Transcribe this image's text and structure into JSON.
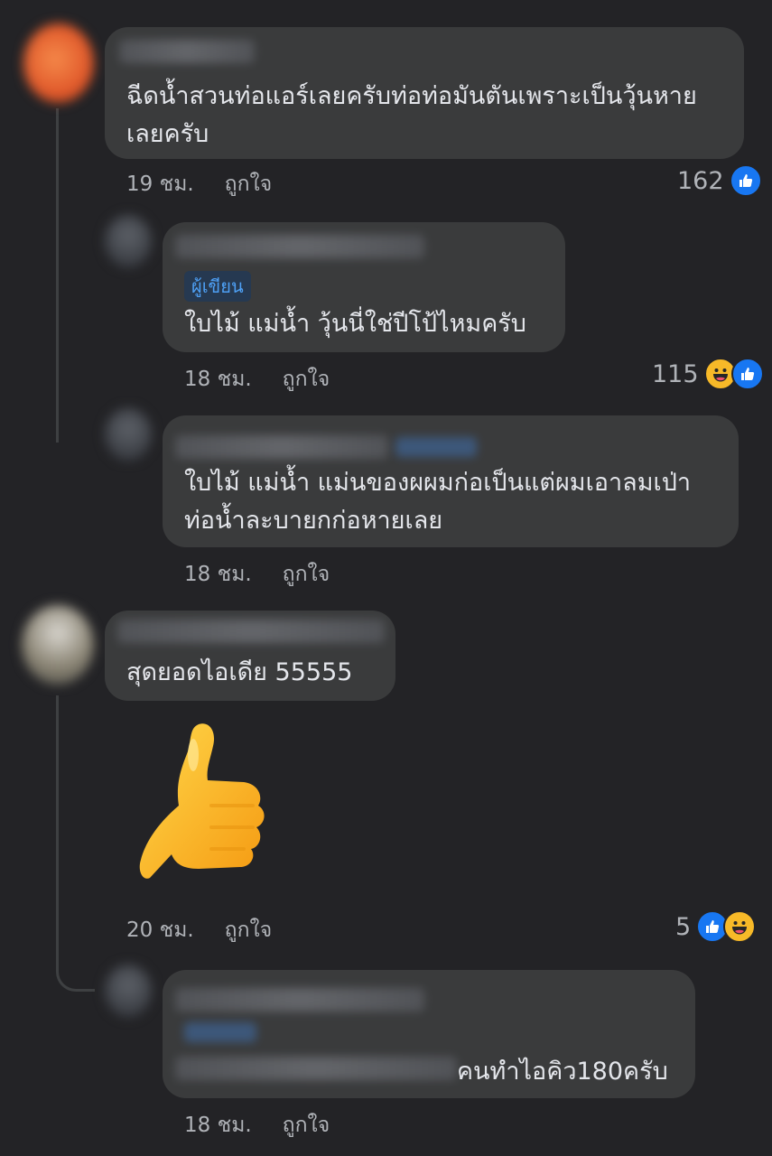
{
  "comments": [
    {
      "text_lines": [
        "ฉีดน้ำสวนท่อแอร์เลยครับท่อท่อมันตันเพราะเป็นวุ้นหาย",
        "เลยครับ"
      ],
      "time": "19 ชม.",
      "like_label": "ถูกใจ",
      "reaction_count": "162",
      "reactions": [
        "like"
      ]
    },
    {
      "badge": "ผู้เขียน",
      "text_lines": [
        "ใบไม้ แม่น้ำ วุ้นนี่ใช่ปีโป้ไหมครับ"
      ],
      "time": "18 ชม.",
      "like_label": "ถูกใจ",
      "reaction_count": "115",
      "reactions": [
        "haha",
        "like"
      ]
    },
    {
      "text_lines": [
        "ใบไม้ แม่น้ำ แม่นของผผมก่อเป็นแต่ผมเอาลมเป่า",
        "ท่อน้ำละบายกก่อหายเลย"
      ],
      "time": "18 ชม.",
      "like_label": "ถูกใจ"
    },
    {
      "text_lines": [
        "สุดยอดไอเดีย 55555"
      ],
      "sticker": "thumbs-up-sticker",
      "time": "20 ชม.",
      "like_label": "ถูกใจ",
      "reaction_count": "5",
      "reactions": [
        "like",
        "haha"
      ]
    },
    {
      "text_lines": [
        "คนทำไอคิว180ครับ"
      ],
      "time": "18 ชม.",
      "like_label": "ถูกใจ"
    }
  ],
  "colors": {
    "background": "#232326",
    "bubble": "#3a3b3c",
    "text": "#e4e6eb",
    "meta": "#b0b3b8",
    "like_blue": "#1877f2",
    "haha_yellow": "#f7b928",
    "author_badge_text": "#4ea0f5"
  }
}
